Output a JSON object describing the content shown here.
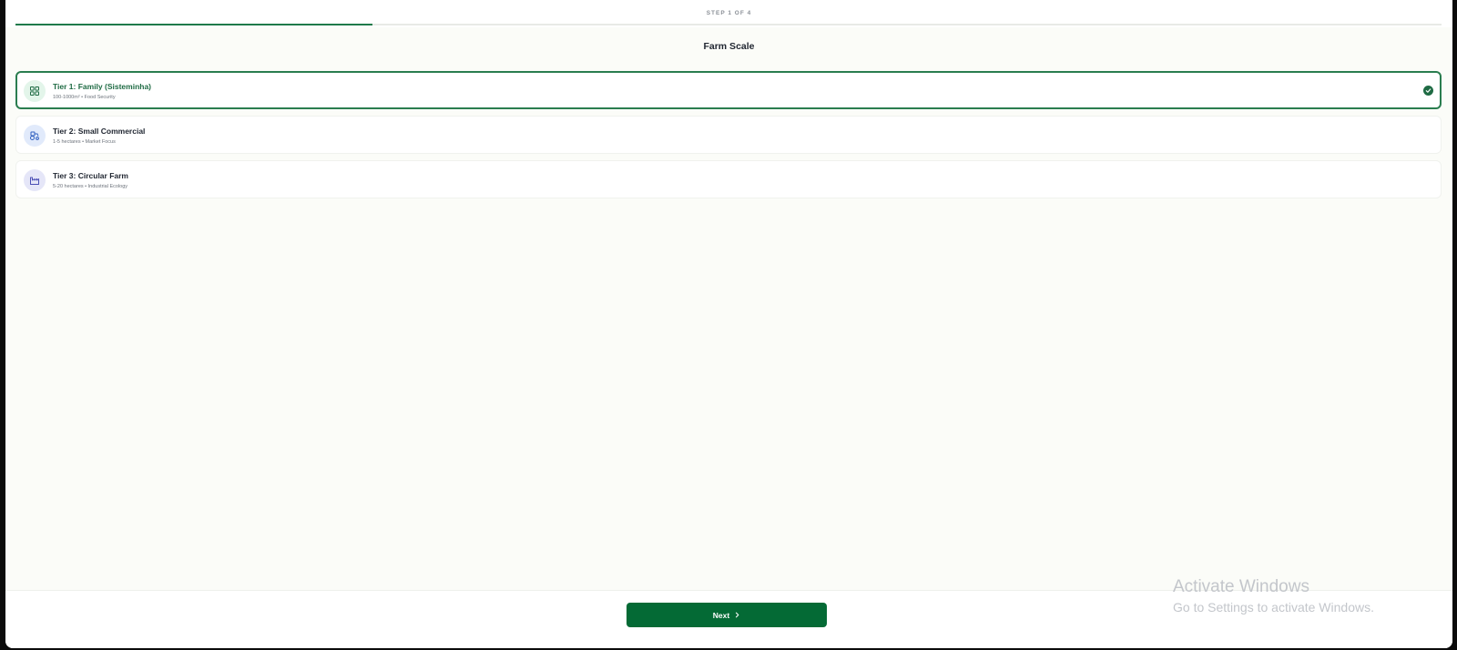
{
  "wizard": {
    "step_label": "STEP 1 OF 4",
    "progress_fraction": 0.25,
    "title": "Farm Scale"
  },
  "options": [
    {
      "title": "Tier 1: Family (Sisteminha)",
      "subtitle": "100-1000m² • Food Security",
      "icon": "grid-icon",
      "selected": true,
      "color": "#1f6b44"
    },
    {
      "title": "Tier 2: Small Commercial",
      "subtitle": "1-5 hectares • Market Focus",
      "icon": "tractor-icon",
      "selected": false,
      "color": "#2f5fbf"
    },
    {
      "title": "Tier 3: Circular Farm",
      "subtitle": "5-20 hectares • Industrial Ecology",
      "icon": "factory-icon",
      "selected": false,
      "color": "#4b4fb5"
    }
  ],
  "footer": {
    "next_label": "Next"
  },
  "watermark": {
    "title": "Activate Windows",
    "subtitle": "Go to Settings to activate Windows."
  },
  "colors": {
    "accent": "#046a35",
    "selected_border": "#2a7d4f",
    "background": "#fbfcf8"
  }
}
